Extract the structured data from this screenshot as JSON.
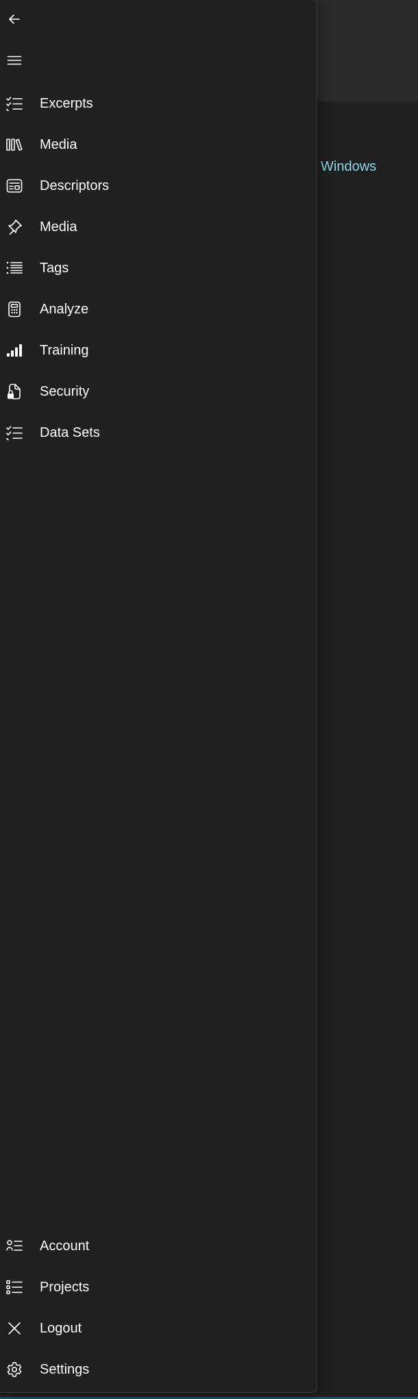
{
  "background": {
    "link_text": "Windows",
    "link_color": "#8fd8e8",
    "accent_color": "#0d5b66"
  },
  "nav": {
    "back_icon": "arrow-left-icon",
    "menu_icon": "hamburger-menu-icon",
    "items": [
      {
        "label": "Excerpts",
        "icon": "checklist-icon"
      },
      {
        "label": "Media",
        "icon": "library-books-icon"
      },
      {
        "label": "Descriptors",
        "icon": "news-card-icon"
      },
      {
        "label": "Media",
        "icon": "pin-icon"
      },
      {
        "label": "Tags",
        "icon": "bulleted-list-icon"
      },
      {
        "label": "Analyze",
        "icon": "calculator-icon"
      },
      {
        "label": "Training",
        "icon": "signal-bars-icon"
      },
      {
        "label": "Security",
        "icon": "document-lock-icon"
      },
      {
        "label": "Data Sets",
        "icon": "checklist-icon"
      }
    ],
    "footer_items": [
      {
        "label": "Account",
        "icon": "person-list-icon"
      },
      {
        "label": "Projects",
        "icon": "bulleted-list-icon"
      },
      {
        "label": "Logout",
        "icon": "close-icon"
      },
      {
        "label": "Settings",
        "icon": "gear-icon"
      }
    ]
  }
}
